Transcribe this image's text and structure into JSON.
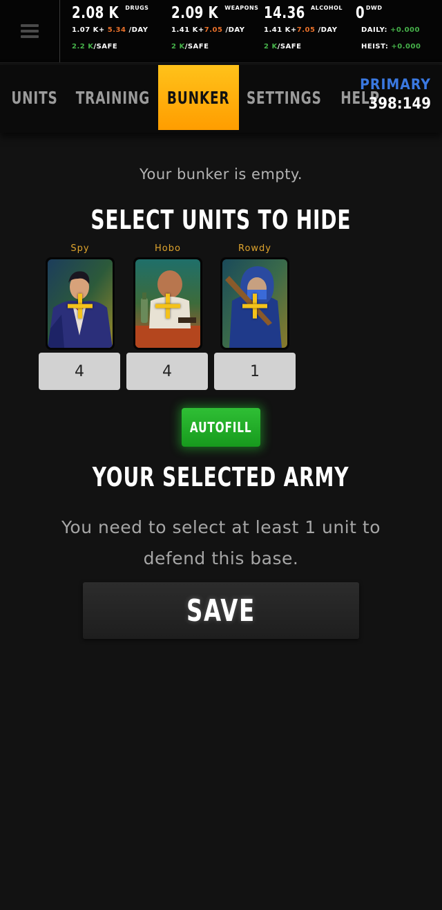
{
  "resources": [
    {
      "amount": "2.08 K",
      "name": "DRUGS",
      "rate_base": "1.07 K+",
      "rate_bonus": "5.34",
      "rate_unit": "/DAY",
      "safe_amount": "2.2 K",
      "safe_label": "/SAFE"
    },
    {
      "amount": "2.09 K",
      "name": "WEAPONS",
      "rate_base": "1.41 K+",
      "rate_bonus": "7.05",
      "rate_unit": "/DAY",
      "safe_amount": "2 K",
      "safe_label": "/SAFE"
    },
    {
      "amount": "14.36",
      "name": "ALCOHOL",
      "rate_base": "1.41 K+",
      "rate_bonus": "7.05",
      "rate_unit": "/DAY",
      "safe_amount": "2 K",
      "safe_label": "/SAFE"
    }
  ],
  "dwd": {
    "amount": "0",
    "name": "DWD",
    "daily_label": "DAILY:",
    "daily_value": "+0.000",
    "heist_label": "HEIST:",
    "heist_value": "+0.000"
  },
  "nav": {
    "tabs": [
      "UNITS",
      "TRAINING",
      "BUNKER",
      "SETTINGS",
      "HELP"
    ],
    "active": "BUNKER",
    "base_label": "PRIMARY",
    "base_coords": "398:149"
  },
  "bunker": {
    "empty_message": "Your bunker is empty.",
    "select_heading": "SELECT UNITS TO HIDE",
    "units": [
      {
        "name": "Spy",
        "quantity": "4"
      },
      {
        "name": "Hobo",
        "quantity": "4"
      },
      {
        "name": "Rowdy",
        "quantity": "1"
      }
    ],
    "autofill_label": "AUTOFILL",
    "army_heading": "YOUR SELECTED ARMY",
    "need_message": "You need to select at least 1 unit to defend this base.",
    "save_label": "SAVE"
  },
  "colors": {
    "active_tab": "#ffb000",
    "primary_label": "#3a78e0",
    "unit_name": "#e0a52e",
    "autofill": "#22ad28",
    "rate_bonus": "#e8702a",
    "safe_amount": "#46b24a"
  }
}
